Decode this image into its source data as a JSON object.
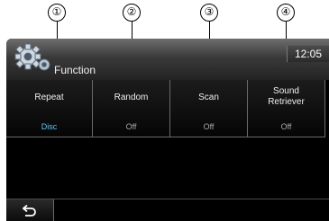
{
  "callouts": [
    "①",
    "②",
    "③",
    "④"
  ],
  "header": {
    "title": "Function",
    "time": "12:05"
  },
  "buttons": [
    {
      "label": "Repeat",
      "value": "Disc"
    },
    {
      "label": "Random",
      "value": "Off"
    },
    {
      "label": "Scan",
      "value": "Off"
    },
    {
      "label": "Sound\nRetriever",
      "value": "Off"
    }
  ],
  "colors": {
    "active_value": "#5cc8ff",
    "inactive_value": "#a8a8a8",
    "screen_bg": "#000000"
  },
  "icons": {
    "header": "gear-icon",
    "back": "back-icon"
  }
}
